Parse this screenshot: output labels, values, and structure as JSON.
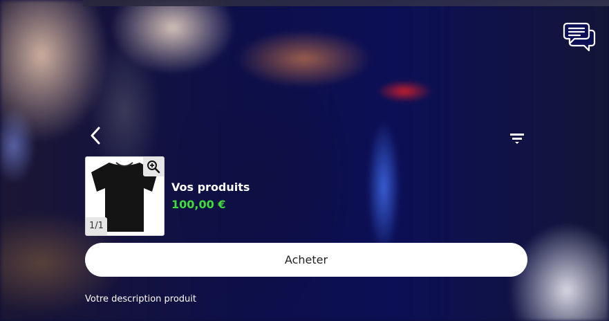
{
  "header": {
    "chat_icon": "chat-bubbles-icon",
    "back_icon": "chevron-left-icon",
    "filter_icon": "filter-lines-icon"
  },
  "product": {
    "name": "Vos produits",
    "price": "100,00 €",
    "price_color": "#3fdc3a",
    "image_counter": "1/1",
    "zoom_icon": "zoom-in-icon",
    "image_subject": "black-tshirt"
  },
  "actions": {
    "buy_label": "Acheter"
  },
  "description": {
    "text": "Votre description produit"
  }
}
